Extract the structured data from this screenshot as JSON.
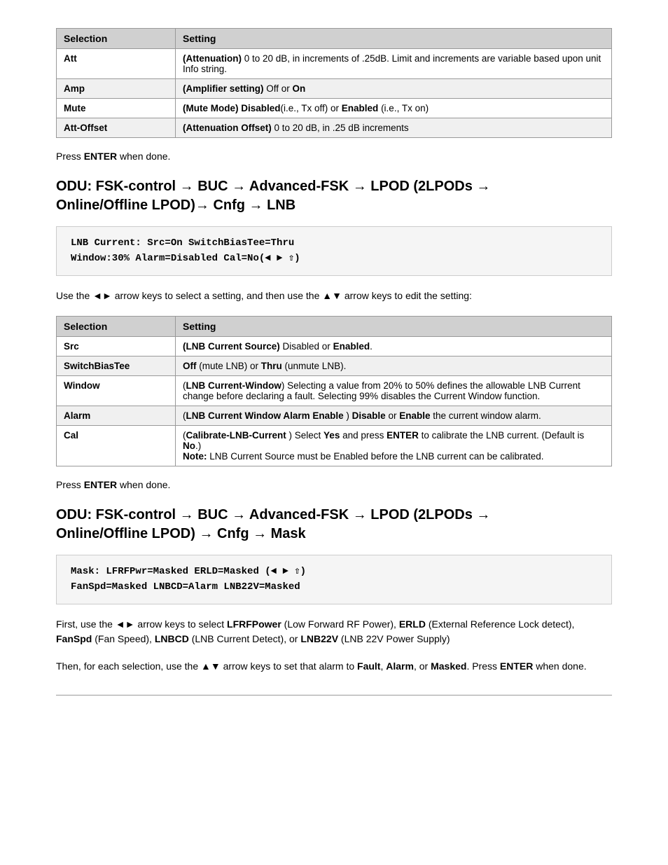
{
  "table1": {
    "headers": [
      "Selection",
      "Setting"
    ],
    "rows": [
      {
        "selection": "Att",
        "setting_bold": "(Attenuation)",
        "setting_rest": " 0 to 20 dB, in increments of .25dB. Limit and increments are variable based upon unit Info string."
      },
      {
        "selection": "Amp",
        "setting_bold": "(Amplifier setting)",
        "setting_rest": " Off or ",
        "setting_bold2": "On"
      },
      {
        "selection": "Mute",
        "setting_bold": "(Mute Mode)",
        "setting_bold_cont": "Disabled",
        "setting_rest": "(i.e., Tx off) or ",
        "setting_bold3": "Enabled",
        "setting_rest2": " (i.e., Tx on)"
      },
      {
        "selection": "Att-Offset",
        "setting_bold": "(Attenuation Offset)",
        "setting_rest": " 0 to 20 dB, in .25 dB increments"
      }
    ]
  },
  "press_enter1": "Press  when done.",
  "section1": {
    "heading": "ODU: FSK-control → BUC → Advanced-FSK → LPOD (2LPODs → Online/Offline LPOD)→ Cnfg → LNB",
    "code_line1": "LNB Current: Src=On    SwitchBiasTee=Thru",
    "code_line2": "Window:30%  Alarm=Disabled  Cal=No(◄ ► ⇧)"
  },
  "instruction1": "Use the ◄► arrow keys to select a setting, and then use the ▲▼ arrow keys to edit the setting:",
  "table2": {
    "headers": [
      "Selection",
      "Setting"
    ],
    "rows": [
      {
        "selection": "Src",
        "setting": "(LNB Current Source) Disabled or Enabled."
      },
      {
        "selection": "SwitchBiasTee",
        "setting": "Off (mute LNB) or Thru (unmute LNB)."
      },
      {
        "selection": "Window",
        "setting": "(LNB Current-Window) Selecting a value from 20% to 50% defines the allowable LNB Current change before declaring a fault. Selecting 99% disables the Current Window function."
      },
      {
        "selection": "Alarm",
        "setting": "(LNB Current Window Alarm Enable ) Disable or Enable the current window alarm."
      },
      {
        "selection": "Cal",
        "setting_parts": [
          {
            "type": "bold_paren",
            "text": "(Calibrate-LNB-Current"
          },
          {
            "type": "normal",
            "text": " ) Select "
          },
          {
            "type": "bold",
            "text": "Yes"
          },
          {
            "type": "normal",
            "text": " and press "
          },
          {
            "type": "bold",
            "text": "ENTER"
          },
          {
            "type": "normal",
            "text": " to calibrate the LNB current. (Default is "
          },
          {
            "type": "bold",
            "text": "No"
          },
          {
            "type": "normal",
            "text": ".)"
          },
          {
            "type": "newline"
          },
          {
            "type": "bold",
            "text": "Note:"
          },
          {
            "type": "normal",
            "text": " LNB Current Source must be Enabled before the LNB current can be calibrated."
          }
        ]
      }
    ]
  },
  "press_enter2": "Press  when done.",
  "section2": {
    "heading": "ODU: FSK-control → BUC → Advanced-FSK → LPOD (2LPODs → Online/Offline LPOD) → Cnfg → Mask",
    "code_line1": "Mask: LFRFPwr=Masked  ERLD=Masked   (◄ ► ⇧)",
    "code_line2": "FanSpd=Masked  LNBCD=Alarm   LNB22V=Masked"
  },
  "instruction2_parts": [
    {
      "type": "normal",
      "text": "First, use the ◄► arrow keys to select "
    },
    {
      "type": "bold",
      "text": "LFRFPower"
    },
    {
      "type": "normal",
      "text": " (Low Forward RF Power), "
    },
    {
      "type": "bold",
      "text": "ERLD"
    },
    {
      "type": "normal",
      "text": " (External Reference Lock detect), "
    },
    {
      "type": "bold",
      "text": "FanSpd"
    },
    {
      "type": "normal",
      "text": " (Fan Speed), "
    },
    {
      "type": "bold",
      "text": "LNBCD"
    },
    {
      "type": "normal",
      "text": " (LNB Current Detect), or "
    },
    {
      "type": "bold",
      "text": "LNB22V"
    },
    {
      "type": "normal",
      "text": " (LNB 22V Power Supply)"
    }
  ],
  "instruction3_parts": [
    {
      "type": "normal",
      "text": "Then, for each selection, use the ▲▼ arrow keys to set that alarm to "
    },
    {
      "type": "bold",
      "text": "Fault"
    },
    {
      "type": "normal",
      "text": ", "
    },
    {
      "type": "bold",
      "text": "Alarm"
    },
    {
      "type": "normal",
      "text": ", or "
    },
    {
      "type": "bold",
      "text": "Masked"
    },
    {
      "type": "normal",
      "text": ". Press "
    },
    {
      "type": "bold",
      "text": "ENTER"
    },
    {
      "type": "normal",
      "text": " when done."
    }
  ]
}
